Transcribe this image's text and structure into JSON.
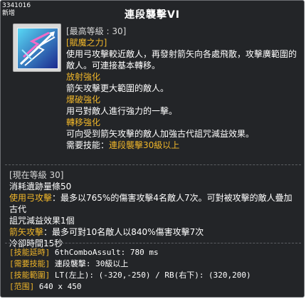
{
  "corner": {
    "id": "3341016",
    "tag": "新增"
  },
  "title": "連段襲擊VI",
  "colors": {
    "gold": "#f1b72a",
    "background": "#232528",
    "border": "#6c6f73"
  },
  "icon": "chain-arrow-skill-icon",
  "header": {
    "max_level": "[最高等級 : 30]",
    "tag": "[賦魔之力]"
  },
  "description": {
    "line1": "使用弓攻擊較近敵人，再發射箭矢向各處飛散，攻擊廣範圍的",
    "line2": "敵人。可連接基本轉移。",
    "diffuse_title": "放射強化",
    "diffuse_text": "箭矢攻擊更大範圍的敵人。",
    "burst_title": "爆破強化",
    "burst_text": "用弓對敵人進行強力的一擊。",
    "transfer_title": "轉移強化",
    "transfer_text": "可向受到箭矢攻擊的敵人加強古代詛咒減益效果。",
    "required_label": "需要技能：",
    "required_value": "連段襲擊30級以上"
  },
  "current": {
    "level": "[現在等級 30]",
    "consume": "消耗遺跡量條50",
    "bow_label": "使用弓攻擊",
    "bow_text": "：最多以765%的傷害攻擊4名敵人7次。可對被攻擊的敵人疊加古代",
    "bow_text2": "詛咒減益效果1個",
    "arrow_label": "箭矢攻擊",
    "arrow_text": "：最多可對10名敵人以840%傷害攻擊7次",
    "cooldown": "冷卻時間15秒"
  },
  "debug": {
    "delay_label": "[技能延時]",
    "delay_value": " 6thComboAssult: 780 ms",
    "req_label": "[需要技能]",
    "req_value": " 連段襲擊: 30級以上",
    "range_label": "[技能範圍]",
    "range_value": " LT(左上): (-320,-250) / RB(右下): (320,200)",
    "area_label": "[范围]",
    "area_value": " 640 x 450"
  }
}
